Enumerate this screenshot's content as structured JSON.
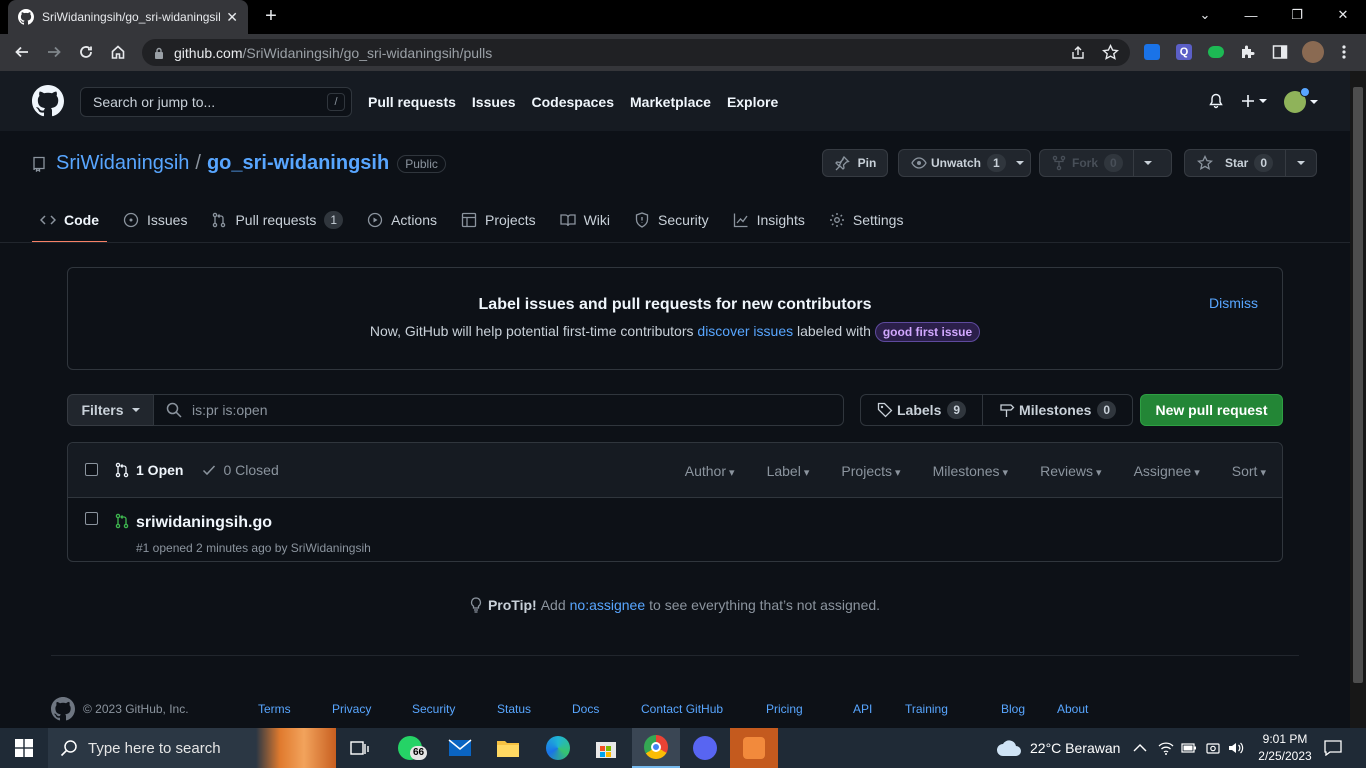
{
  "browser": {
    "tab_title": "SriWidaningsih/go_sri-widaningsih",
    "tab_close": "✕",
    "new_tab": "+",
    "url_host": "github.com",
    "url_path": "/SriWidaningsih/go_sri-widaningsih/pulls"
  },
  "header": {
    "search_placeholder": "Search or jump to...",
    "search_key": "/",
    "nav": [
      "Pull requests",
      "Issues",
      "Codespaces",
      "Marketplace",
      "Explore"
    ]
  },
  "repo": {
    "owner": "SriWidaningsih",
    "separator": "/",
    "name": "go_sri-widaningsih",
    "visibility": "Public",
    "pin_label": "Pin",
    "watch_label": "Unwatch",
    "watch_count": "1",
    "fork_label": "Fork",
    "fork_count": "0",
    "star_label": "Star",
    "star_count": "0"
  },
  "tabs": [
    {
      "label": "Code",
      "icon": "code-icon"
    },
    {
      "label": "Issues",
      "icon": "issue-icon"
    },
    {
      "label": "Pull requests",
      "icon": "pull-request-icon",
      "count": "1"
    },
    {
      "label": "Actions",
      "icon": "play-icon"
    },
    {
      "label": "Projects",
      "icon": "table-icon"
    },
    {
      "label": "Wiki",
      "icon": "book-icon"
    },
    {
      "label": "Security",
      "icon": "shield-icon"
    },
    {
      "label": "Insights",
      "icon": "graph-icon"
    },
    {
      "label": "Settings",
      "icon": "gear-icon"
    }
  ],
  "banner": {
    "title": "Label issues and pull requests for new contributors",
    "text_before": "Now, GitHub will help potential first-time contributors",
    "link": "discover issues",
    "text_after": "labeled with",
    "label": "good first issue",
    "dismiss": "Dismiss"
  },
  "filters": {
    "button": "Filters",
    "query": "is:pr is:open",
    "labels_label": "Labels",
    "labels_count": "9",
    "milestones_label": "Milestones",
    "milestones_count": "0",
    "new_pr": "New pull request"
  },
  "list": {
    "open": "1 Open",
    "closed": "0 Closed",
    "sorters": [
      "Author",
      "Label",
      "Projects",
      "Milestones",
      "Reviews",
      "Assignee",
      "Sort"
    ],
    "items": [
      {
        "title": "sriwidaningsih.go",
        "meta": "#1 opened 2 minutes ago by SriWidaningsih"
      }
    ]
  },
  "protip": {
    "lead": "ProTip!",
    "before": "Add",
    "link": "no:assignee",
    "after": "to see everything that’s not assigned."
  },
  "footer": {
    "copyright": "© 2023 GitHub, Inc.",
    "links": [
      "Terms",
      "Privacy",
      "Security",
      "Status",
      "Docs",
      "Contact GitHub",
      "Pricing",
      "API",
      "Training",
      "Blog",
      "About"
    ]
  },
  "taskbar": {
    "search_placeholder": "Type here to search",
    "whatsapp_badge": "66",
    "weather": "22°C  Berawan",
    "time": "9:01 PM",
    "date": "2/25/2023"
  },
  "colors": {
    "accent_green": "#238636",
    "link_blue": "#58a6ff",
    "active_tab": "#f78166"
  }
}
